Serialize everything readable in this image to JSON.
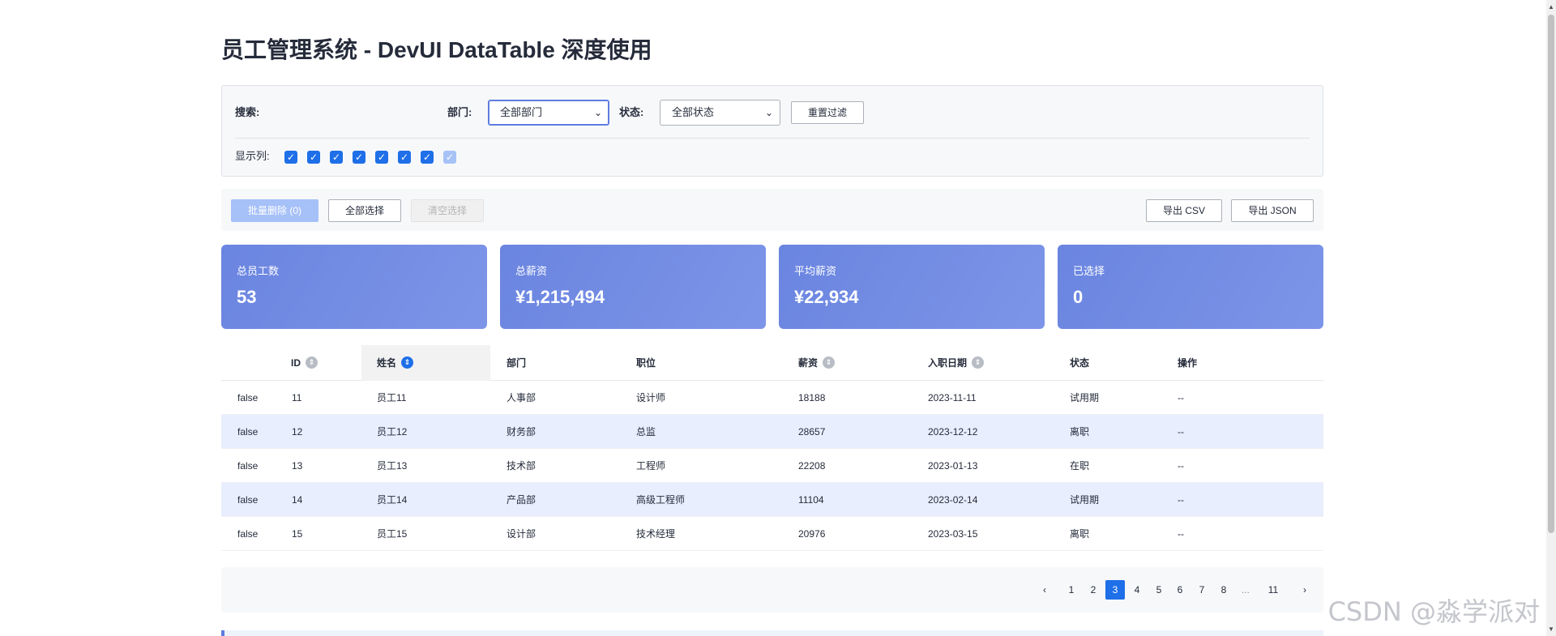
{
  "page": {
    "title": "员工管理系统 - DevUI DataTable 深度使用"
  },
  "filters": {
    "search_label": "搜索:",
    "dept_label": "部门:",
    "dept_value": "全部部门",
    "status_label": "状态:",
    "status_value": "全部状态",
    "reset_label": "重置过滤",
    "columns_label": "显示列:",
    "column_checks": [
      true,
      true,
      true,
      true,
      true,
      true,
      true,
      true
    ]
  },
  "toolbar": {
    "batch_delete": "批量删除 (0)",
    "select_all": "全部选择",
    "clear_selection": "清空选择",
    "export_csv": "导出 CSV",
    "export_json": "导出 JSON"
  },
  "stats": [
    {
      "label": "总员工数",
      "value": "53"
    },
    {
      "label": "总薪资",
      "value": "¥1,215,494"
    },
    {
      "label": "平均薪资",
      "value": "¥22,934"
    },
    {
      "label": "已选择",
      "value": "0"
    }
  ],
  "table": {
    "headers": [
      "ID",
      "姓名",
      "部门",
      "职位",
      "薪资",
      "入职日期",
      "状态",
      "操作"
    ],
    "rows": [
      [
        "false",
        "11",
        "员工11",
        "人事部",
        "设计师",
        "18188",
        "2023-11-11",
        "试用期",
        "--"
      ],
      [
        "false",
        "12",
        "员工12",
        "财务部",
        "总监",
        "28657",
        "2023-12-12",
        "离职",
        "--"
      ],
      [
        "false",
        "13",
        "员工13",
        "技术部",
        "工程师",
        "22208",
        "2023-01-13",
        "在职",
        "--"
      ],
      [
        "false",
        "14",
        "员工14",
        "产品部",
        "高级工程师",
        "11104",
        "2023-02-14",
        "试用期",
        "--"
      ],
      [
        "false",
        "15",
        "员工15",
        "设计部",
        "技术经理",
        "20976",
        "2023-03-15",
        "离职",
        "--"
      ]
    ]
  },
  "pagination": {
    "prev": "‹",
    "next": "›",
    "pages": [
      "1",
      "2",
      "3",
      "4",
      "5",
      "6",
      "7",
      "8",
      "...",
      "11"
    ],
    "current": "3"
  },
  "watermark": "CSDN @淼学派对",
  "colors": {
    "primary": "#1e6fe8",
    "card": "#6a85e0",
    "row_alt": "#e8eefd"
  }
}
